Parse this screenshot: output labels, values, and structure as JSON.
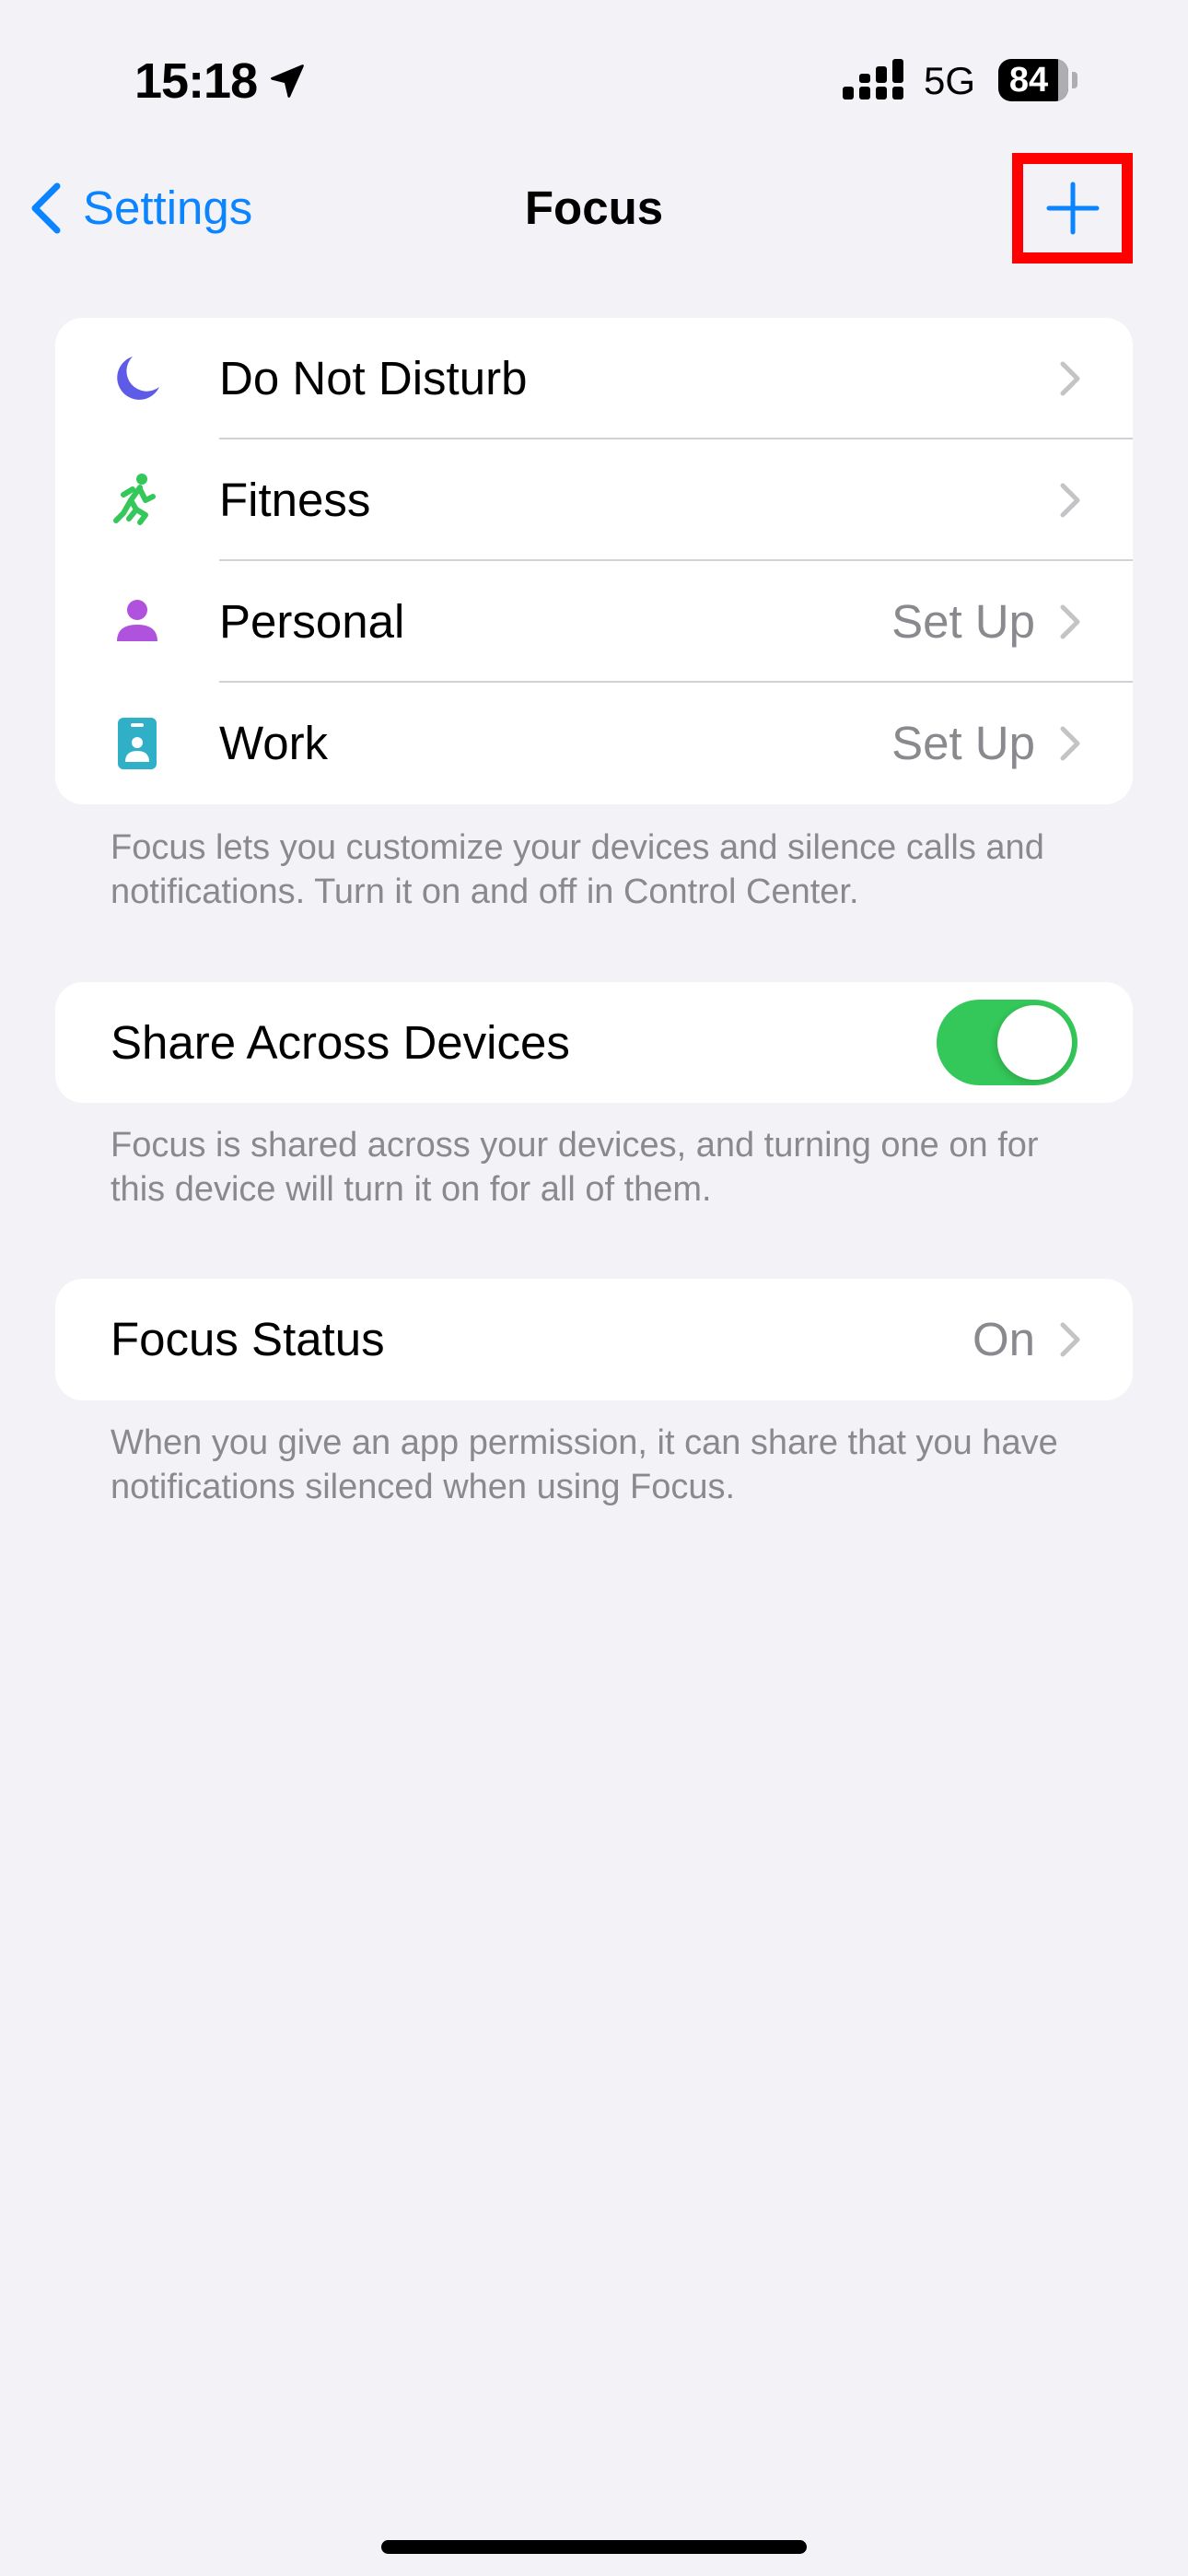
{
  "status_bar": {
    "time": "15:18",
    "location_icon": "location-arrow-icon",
    "signal_icon": "cellular-signal-icon",
    "network": "5G",
    "battery_percent": "84",
    "battery_level": 0.84
  },
  "nav": {
    "back_label": "Settings",
    "title": "Focus",
    "add_icon": "plus-icon",
    "highlight_color": "#ff0000",
    "accent_color": "#0a84ff"
  },
  "focus_modes": {
    "items": [
      {
        "label": "Do Not Disturb",
        "value": "",
        "icon": "moon-icon",
        "color": "#5e5ce6"
      },
      {
        "label": "Fitness",
        "value": "",
        "icon": "running-figure-icon",
        "color": "#34c759"
      },
      {
        "label": "Personal",
        "value": "Set Up",
        "icon": "person-icon",
        "color": "#af52de"
      },
      {
        "label": "Work",
        "value": "Set Up",
        "icon": "id-badge-icon",
        "color": "#30b0c7"
      }
    ],
    "footer": "Focus lets you customize your devices and silence calls and notifications. Turn it on and off in Control Center."
  },
  "share_across_devices": {
    "label": "Share Across Devices",
    "enabled": true,
    "toggle_color": "#34c759",
    "footer": "Focus is shared across your devices, and turning one on for this device will turn it on for all of them."
  },
  "focus_status": {
    "label": "Focus Status",
    "value": "On",
    "footer": "When you give an app permission, it can share that you have notifications silenced when using Focus."
  }
}
